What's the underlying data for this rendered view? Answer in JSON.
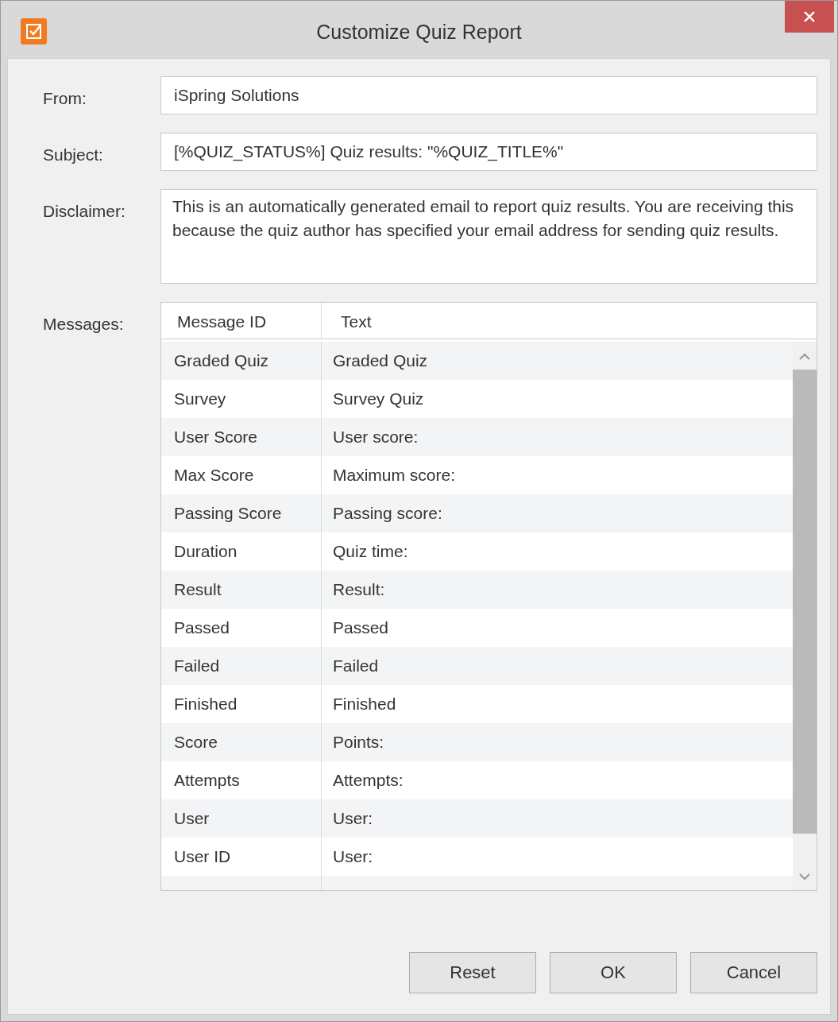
{
  "window": {
    "title": "Customize Quiz Report"
  },
  "fields": [
    {
      "label": "From:",
      "value": "iSpring Solutions",
      "kind": "input"
    },
    {
      "label": "Subject:",
      "value": "[%QUIZ_STATUS%] Quiz results: \"%QUIZ_TITLE%\"",
      "kind": "input"
    },
    {
      "label": "Disclaimer:",
      "value": "This is an automatically generated email to report quiz results. You are receiving this because the quiz author has specified your email address for sending quiz results.",
      "kind": "textarea"
    }
  ],
  "messages": {
    "label": "Messages:",
    "columns": [
      "Message ID",
      "Text"
    ],
    "rows": [
      [
        "Graded Quiz",
        "Graded Quiz"
      ],
      [
        "Survey",
        "Survey Quiz"
      ],
      [
        "User Score",
        "User score:"
      ],
      [
        "Max Score",
        "Maximum score:"
      ],
      [
        "Passing Score",
        "Passing score:"
      ],
      [
        "Duration",
        "Quiz time:"
      ],
      [
        "Result",
        "Result:"
      ],
      [
        "Passed",
        "Passed"
      ],
      [
        "Failed",
        "Failed"
      ],
      [
        "Finished",
        "Finished"
      ],
      [
        "Score",
        "Points:"
      ],
      [
        "Attempts",
        "Attempts:"
      ],
      [
        "User",
        "User:"
      ],
      [
        "User ID",
        "User:"
      ]
    ]
  },
  "buttons": [
    "Reset",
    "OK",
    "Cancel"
  ]
}
